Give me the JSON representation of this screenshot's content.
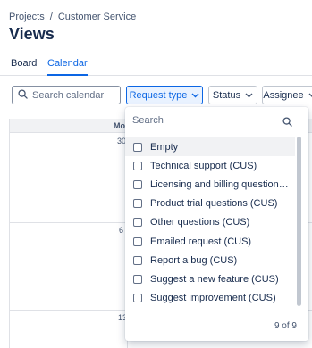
{
  "breadcrumb": {
    "project": "Projects",
    "separator": "/",
    "current": "Customer Service"
  },
  "page": {
    "title": "Views"
  },
  "tabs": [
    {
      "label": "Board",
      "active": false
    },
    {
      "label": "Calendar",
      "active": true
    }
  ],
  "toolbar": {
    "search": {
      "placeholder": "Search calendar",
      "icon": "search-icon"
    },
    "request_type_label": "Request type",
    "status_label": "Status",
    "assignee_label": "Assignee"
  },
  "calendar": {
    "day_header": "Mo",
    "dates": [
      "30",
      "6",
      "13"
    ]
  },
  "dropdown": {
    "search_placeholder": "Search",
    "options": [
      {
        "label": "Empty",
        "checked": false
      },
      {
        "label": "Technical support (CUS)",
        "checked": false
      },
      {
        "label": "Licensing and billing questions (C...",
        "checked": false
      },
      {
        "label": "Product trial questions (CUS)",
        "checked": false
      },
      {
        "label": "Other questions (CUS)",
        "checked": false
      },
      {
        "label": "Emailed request (CUS)",
        "checked": false
      },
      {
        "label": "Report a bug (CUS)",
        "checked": false
      },
      {
        "label": "Suggest a new feature (CUS)",
        "checked": false
      },
      {
        "label": "Suggest improvement (CUS)",
        "checked": false
      }
    ],
    "count": "9 of 9"
  },
  "colors": {
    "accent": "#0c66e4",
    "text": "#172b4d",
    "muted": "#44546f",
    "border": "#dfe1e6"
  }
}
